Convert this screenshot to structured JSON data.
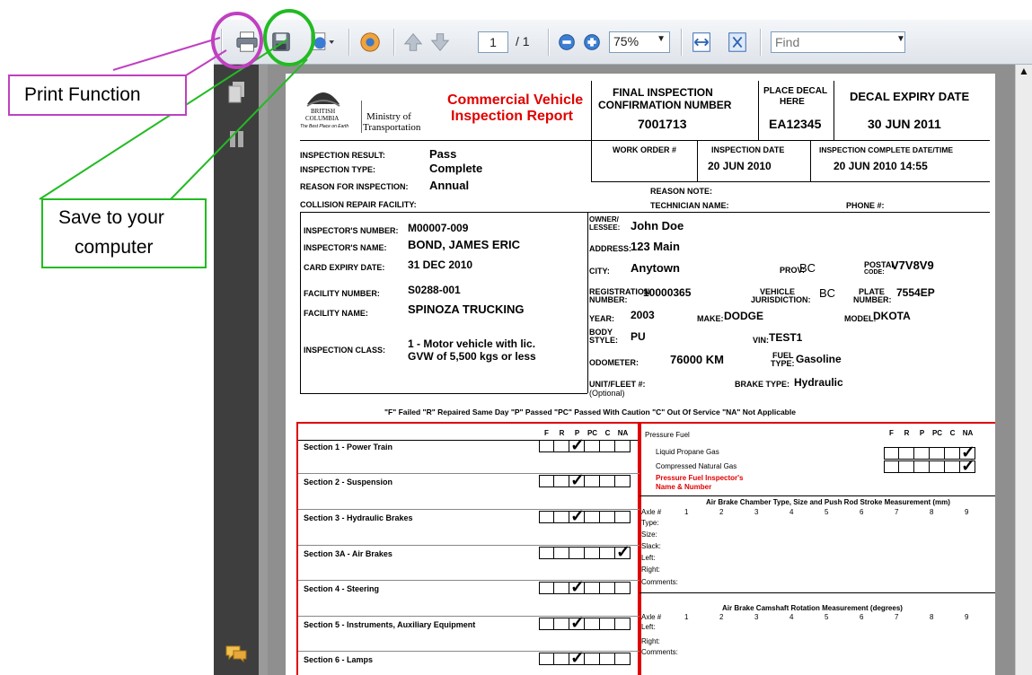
{
  "toolbar": {
    "page_current": "1",
    "page_total": "/ 1",
    "zoom": "75%",
    "find_placeholder": "Find",
    "icons": [
      "print-icon",
      "save-icon",
      "export-icon",
      "share-icon",
      "prev-page-icon",
      "next-page-icon",
      "zoom-out-icon",
      "zoom-in-icon",
      "fit-width-icon",
      "fit-page-icon"
    ]
  },
  "annotations": {
    "print": "Print Function",
    "save_line1": "Save to your",
    "save_line2": "computer",
    "print_color": "#c040c0",
    "save_color": "#22bb22"
  },
  "report": {
    "logo_line1": "BRITISH",
    "logo_line2": "COLUMBIA",
    "logo_tag": "The Best Place on Earth",
    "ministry_line1": "Ministry of",
    "ministry_line2": "Transportation",
    "title_line1": "Commercial Vehicle",
    "title_line2": "Inspection Report",
    "final_insp_label1": "FINAL INSPECTION",
    "final_insp_label2": "CONFIRMATION NUMBER",
    "final_insp_value": "7001713",
    "place_decal_label1": "PLACE DECAL",
    "place_decal_label2": "HERE",
    "place_decal_value": "EA12345",
    "decal_expiry_label": "DECAL EXPIRY DATE",
    "decal_expiry_value": "30  JUN  2011",
    "inspection_result_label": "INSPECTION RESULT:",
    "inspection_result": "Pass",
    "inspection_type_label": "INSPECTION TYPE:",
    "inspection_type": "Complete",
    "reason_label": "REASON FOR INSPECTION:",
    "reason": "Annual",
    "collision_label": "COLLISION REPAIR FACILITY:",
    "work_order_label": "WORK ORDER #",
    "inspection_date_label": "INSPECTION DATE",
    "inspection_date": "20  JUN  2010",
    "complete_dt_label": "INSPECTION COMPLETE DATE/TIME",
    "complete_dt": "20  JUN  2010 14:55",
    "reason_note_label": "REASON NOTE:",
    "technician_label": "TECHNICIAN NAME:",
    "phone_label": "PHONE #:",
    "inspector_number_label": "INSPECTOR'S NUMBER:",
    "inspector_number": "M00007-009",
    "inspector_name_label": "INSPECTOR'S NAME:",
    "inspector_name": "BOND, JAMES ERIC",
    "card_expiry_label": "CARD EXPIRY DATE:",
    "card_expiry": "31  DEC  2010",
    "facility_number_label": "FACILITY NUMBER:",
    "facility_number": "S0288-001",
    "facility_name_label": "FACILITY NAME:",
    "facility_name": "SPINOZA TRUCKING",
    "inspection_class_label": "INSPECTION CLASS:",
    "inspection_class_1": "1 - Motor vehicle with lic.",
    "inspection_class_2": "GVW of 5,500 kgs or less",
    "owner_label1": "OWNER/",
    "owner_label2": "LESSEE:",
    "owner": "John Doe",
    "address_label": "ADDRESS:",
    "address": "123 Main",
    "city_label": "CITY:",
    "city": "Anytown",
    "prov_label": "PROV:",
    "prov": "BC",
    "postal_label1": "POSTAL",
    "postal_label2": "CODE:",
    "postal": "V7V8V9",
    "registration_label1": "REGISTRATION",
    "registration_label2": "NUMBER:",
    "registration": "10000365",
    "vehicle_juris_label1": "VEHICLE",
    "vehicle_juris_label2": "JURISDICTION:",
    "vehicle_juris": "BC",
    "plate_label1": "PLATE",
    "plate_label2": "NUMBER:",
    "plate": "7554EP",
    "year_label": "YEAR:",
    "year": "2003",
    "make_label": "MAKE:",
    "make": "DODGE",
    "model_label": "MODEL:",
    "model": "DKOTA",
    "body_label1": "BODY",
    "body_label2": "STYLE:",
    "body": "PU",
    "vin_label": "VIN:",
    "vin": "TEST1",
    "odometer_label": "ODOMETER:",
    "odometer": "76000 KM",
    "fuel_label1": "FUEL",
    "fuel_label2": "TYPE:",
    "fuel": "Gasoline",
    "unit_label1": "UNIT/FLEET #:",
    "unit_label2": "(Optional)",
    "brake_label": "BRAKE TYPE:",
    "brake": "Hydraulic",
    "legend": "\"F\" Failed   \"R\" Repaired Same Day   \"P\" Passed   \"PC\" Passed With Caution   \"C\" Out Of Service   \"NA\" Not Applicable"
  },
  "grid": {
    "columns": [
      "F",
      "R",
      "P",
      "PC",
      "C",
      "NA"
    ],
    "sections": [
      {
        "label": "Section 1 - Power Train",
        "check": "P"
      },
      {
        "label": "Section 2 - Suspension",
        "check": "P"
      },
      {
        "label": "Section 3 - Hydraulic Brakes",
        "check": "P"
      },
      {
        "label": "Section 3A - Air Brakes",
        "check": "NA"
      },
      {
        "label": "Section 4 - Steering",
        "check": "P"
      },
      {
        "label": "Section 5 - Instruments, Auxiliary Equipment",
        "check": "P"
      },
      {
        "label": "Section 6 - Lamps",
        "check": "P"
      }
    ],
    "pressure_fuel": "Pressure Fuel",
    "lpg": "Liquid Propane Gas",
    "cng": "Compressed Natural Gas",
    "pf_inspector_1": "Pressure Fuel Inspector's",
    "pf_inspector_2": "Name & Number",
    "air_brake_title": "Air Brake Chamber Type, Size and Push Rod Stroke Measurement (mm)",
    "axle_label": "Axle #",
    "axle_numbers": [
      "1",
      "2",
      "3",
      "4",
      "5",
      "6",
      "7",
      "8",
      "9"
    ],
    "type_label": "Type:",
    "size_label": "Size:",
    "slack_label": "Slack:",
    "left_label": "Left:",
    "right_label": "Right:",
    "comments_label": "Comments:",
    "camshaft_title": "Air Brake Camshaft Rotation Measurement (degrees)"
  }
}
